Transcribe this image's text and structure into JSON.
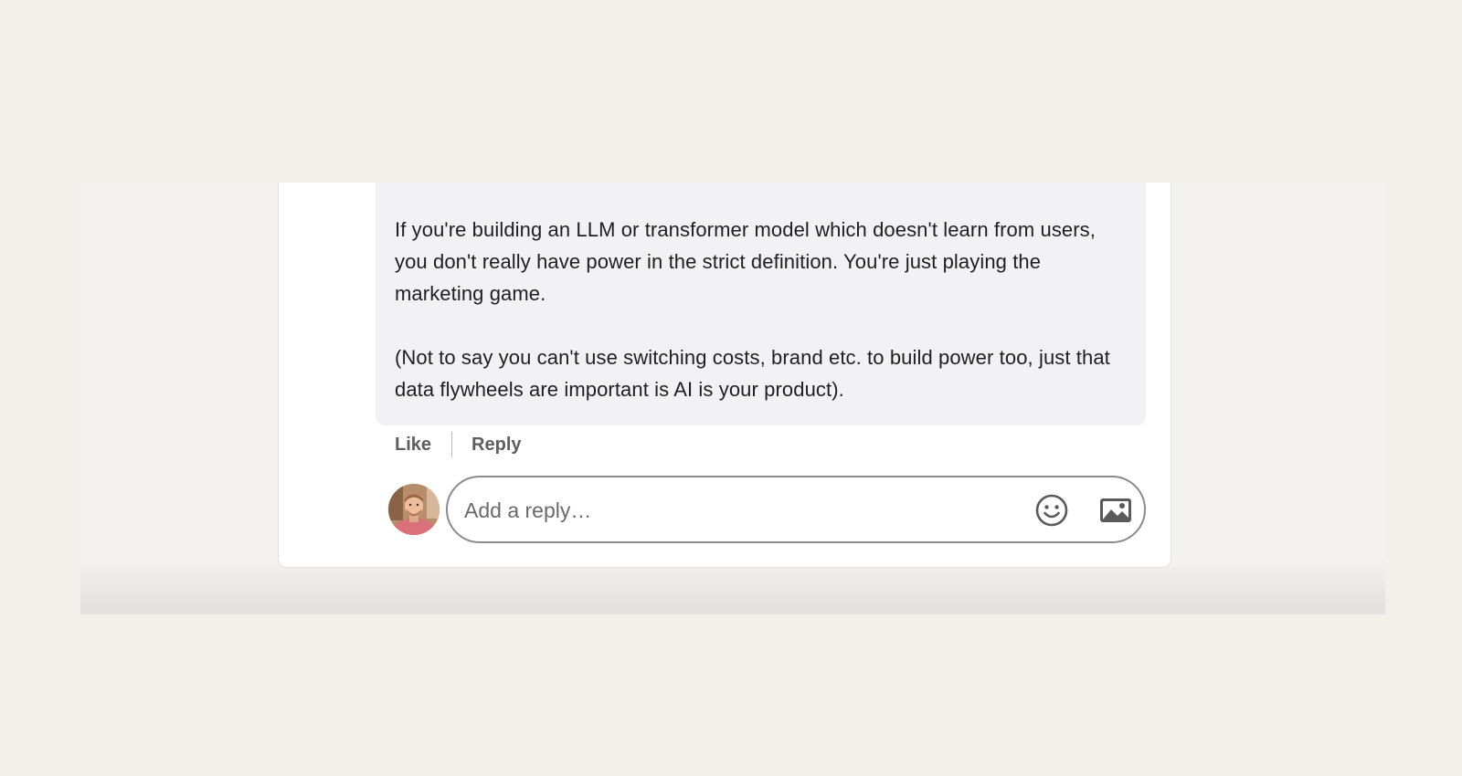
{
  "comment": {
    "paragraphs": [
      "If you're building an LLM or transformer model which doesn't learn from users, you don't really have power in the strict definition. You're just playing the marketing game.",
      "(Not to say you can't use switching costs, brand etc. to build power too, just that data flywheels are important is AI is your product)."
    ]
  },
  "actions": {
    "like_label": "Like",
    "reply_label": "Reply"
  },
  "reply_box": {
    "placeholder": "Add a reply…",
    "emoji_icon": "emoji-icon",
    "image_icon": "image-icon"
  },
  "colors": {
    "page_background": "#f3f0ea",
    "bubble_background": "#f2f1f4",
    "action_text": "#5e5e5e",
    "input_border": "#8b8b8b"
  }
}
